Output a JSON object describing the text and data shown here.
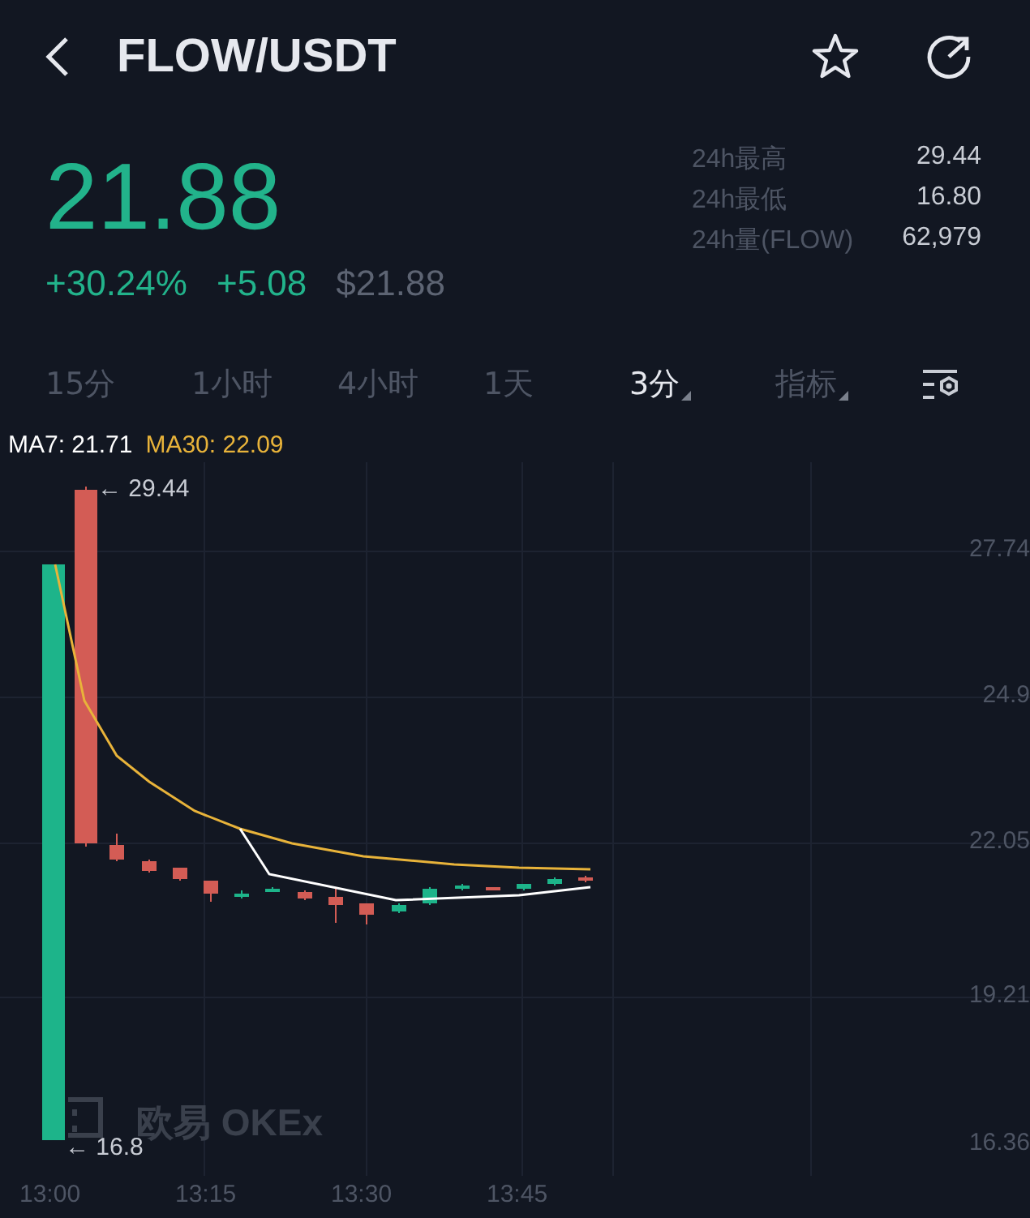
{
  "header": {
    "title": "FLOW/USDT"
  },
  "price": {
    "last": "21.88",
    "change_pct": "+30.24%",
    "change": "+5.08",
    "usd": "$21.88"
  },
  "stats": [
    {
      "label": "24h最高",
      "value": "29.44"
    },
    {
      "label": "24h最低",
      "value": "16.80"
    },
    {
      "label": "24h量(FLOW)",
      "value": "62,979"
    }
  ],
  "intervals": [
    {
      "label": "15分",
      "selected": false,
      "dropdown": false
    },
    {
      "label": "1小时",
      "selected": false,
      "dropdown": false
    },
    {
      "label": "4小时",
      "selected": false,
      "dropdown": false
    },
    {
      "label": "1天",
      "selected": false,
      "dropdown": false
    },
    {
      "label": "3分",
      "selected": true,
      "dropdown": true
    },
    {
      "label": "指标",
      "selected": false,
      "dropdown": true
    }
  ],
  "chart": {
    "legend": [
      {
        "label": "MA7: 21.71",
        "color": "#ffffff"
      },
      {
        "label": "MA30: 22.09",
        "color": "#e8b33a"
      }
    ],
    "high_marker": "← 29.44",
    "low_marker": "← 16.8",
    "price_labels": [
      "27.74",
      "24.9",
      "22.05",
      "19.21",
      "16.36"
    ],
    "time_labels": [
      "13:00",
      "13:15",
      "13:30",
      "13:45"
    ],
    "watermark": "欧易 OKEx"
  }
}
